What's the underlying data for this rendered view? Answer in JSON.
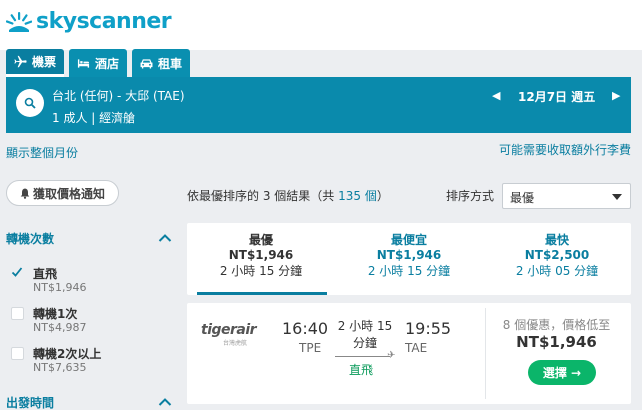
{
  "brand": {
    "name": "skyscanner",
    "color": "#0fa0c8"
  },
  "tabs": [
    {
      "label": "機票",
      "icon": "plane-icon",
      "active": true
    },
    {
      "label": "酒店",
      "icon": "bed-icon",
      "active": false
    },
    {
      "label": "租車",
      "icon": "car-icon",
      "active": false
    }
  ],
  "search": {
    "route": "台北 (任何) - 大邱 (TAE)",
    "passengers": "1 成人 | 經濟艙",
    "date": "12月7日 週五"
  },
  "links": {
    "month_view": "顯示整個月份",
    "fees": "可能需要收取額外行李費"
  },
  "alert_button": "獲取價格通知",
  "filters": {
    "stops_title": "轉機次數",
    "options": [
      {
        "label": "直飛",
        "price": "NT$1,946",
        "checked": true
      },
      {
        "label": "轉機1次",
        "price": "NT$4,987",
        "checked": false
      },
      {
        "label": "轉機2次以上",
        "price": "NT$7,635",
        "checked": false
      }
    ],
    "time_title": "出發時間"
  },
  "results": {
    "summary_prefix": "依最優排序的 3 個結果（共 ",
    "total": "135 個",
    "summary_suffix": "）",
    "sort_label": "排序方式",
    "sort_value": "最優"
  },
  "sort_cards": [
    {
      "title": "最優",
      "price": "NT$1,946",
      "duration": "2 小時 15 分鐘",
      "active": true
    },
    {
      "title": "最便宜",
      "price": "NT$1,946",
      "duration": "2 小時 15 分鐘",
      "active": false
    },
    {
      "title": "最快",
      "price": "NT$2,500",
      "duration": "2 小時 05 分鐘",
      "active": false
    }
  ],
  "flight": {
    "airline": "tigerair",
    "airline_sub": "台灣虎航",
    "dep_time": "16:40",
    "dep_code": "TPE",
    "duration": "2 小時 15 分鐘",
    "stops": "直飛",
    "arr_time": "19:55",
    "arr_code": "TAE",
    "deals": "8 個優惠，價格低至",
    "price": "NT$1,946",
    "select_label": "選擇 →"
  },
  "colors": {
    "primary": "#0a8aac",
    "link": "#0a7ea0",
    "cta": "#0bb56a"
  }
}
